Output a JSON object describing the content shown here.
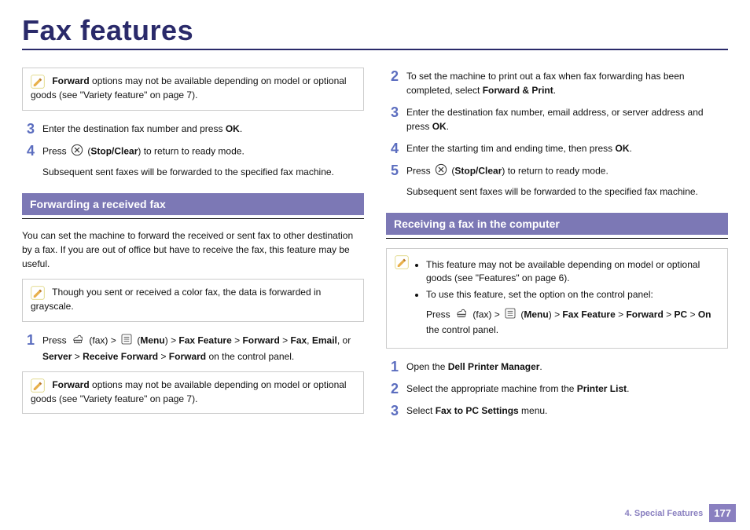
{
  "page": {
    "title": "Fax features",
    "chapter_label": "4.  Special Features",
    "page_number": "177"
  },
  "left": {
    "note1_pre": "Forward",
    "note1_post": " options may not be available depending on model or optional goods (see \"Variety feature\" on page 7).",
    "step3": {
      "num": "3",
      "t": "Enter the destination fax number and press ",
      "b": "OK",
      "post": "."
    },
    "step4": {
      "num": "4",
      "t1": "Press ",
      "t2": " (",
      "b": "Stop/Clear",
      "t3": ") to return to ready mode.",
      "sub": "Subsequent sent faxes will be forwarded to the specified fax machine."
    },
    "section1_title": "Forwarding a received fax",
    "intro": "You can set the machine to forward the received or sent fax to other destination by a fax. If you are out of office but have to receive the fax, this feature may be useful.",
    "note2": "Though you sent or received a color fax, the data is forwarded in grayscale.",
    "fstep1": {
      "num": "1",
      "p1": "Press ",
      "p2": " (fax) > ",
      "p3": " (",
      "b1": "Menu",
      "p4": ") > ",
      "b2": "Fax Feature",
      "p5": " > ",
      "b3": "Forward",
      "p6": " > ",
      "b4": "Fax",
      "p7": ", ",
      "b5": "Email",
      "p8": ", or ",
      "b6": "Server",
      "p9": " > ",
      "b7": "Receive Forward",
      "p10": " > ",
      "b8": "Forward",
      "p11": " on the control panel."
    },
    "note3_pre": "Forward",
    "note3_post": " options may not be available depending on model or optional goods (see \"Variety feature\" on page 7)."
  },
  "right": {
    "step2": {
      "num": "2",
      "t": "To set the machine to print out a fax when fax forwarding has been completed, select ",
      "b": "Forward & Print",
      "post": "."
    },
    "step3": {
      "num": "3",
      "t": "Enter the destination fax number, email address, or server address and press ",
      "b": "OK",
      "post": "."
    },
    "step4": {
      "num": "4",
      "t": "Enter the starting tim and ending time, then press ",
      "b": "OK",
      "post": "."
    },
    "step5": {
      "num": "5",
      "t1": "Press ",
      "t2": " (",
      "b": "Stop/Clear",
      "t3": ") to return to ready mode.",
      "sub": "Subsequent sent faxes will be forwarded to the specified fax machine."
    },
    "section2_title": "Receiving a fax in the computer",
    "note4_li1": "This feature may not be available depending on model or optional goods (see \"Features\" on page 6).",
    "note4_li2": "To use this feature, set the option on the control panel:",
    "note4_path": {
      "p1": "Press ",
      "p2": " (fax) > ",
      "p3": " (",
      "b1": "Menu",
      "p4": ") > ",
      "b2": "Fax Feature",
      "p5": " > ",
      "b3": "Forward",
      "p6": " > ",
      "b4": "PC",
      "p7": " > ",
      "b5": "On",
      "p8": " the control panel."
    },
    "rstep1": {
      "num": "1",
      "t": "Open the ",
      "b": "Dell Printer Manager",
      "post": "."
    },
    "rstep2": {
      "num": "2",
      "t": "Select the appropriate machine from the ",
      "b": "Printer List",
      "post": "."
    },
    "rstep3": {
      "num": "3",
      "t": "Select ",
      "b": "Fax to PC Settings",
      "post": " menu."
    }
  },
  "icons": {
    "pencil_title": "note-icon",
    "stop_title": "stop-clear-icon",
    "fax_title": "fax-icon",
    "menu_title": "menu-icon"
  }
}
